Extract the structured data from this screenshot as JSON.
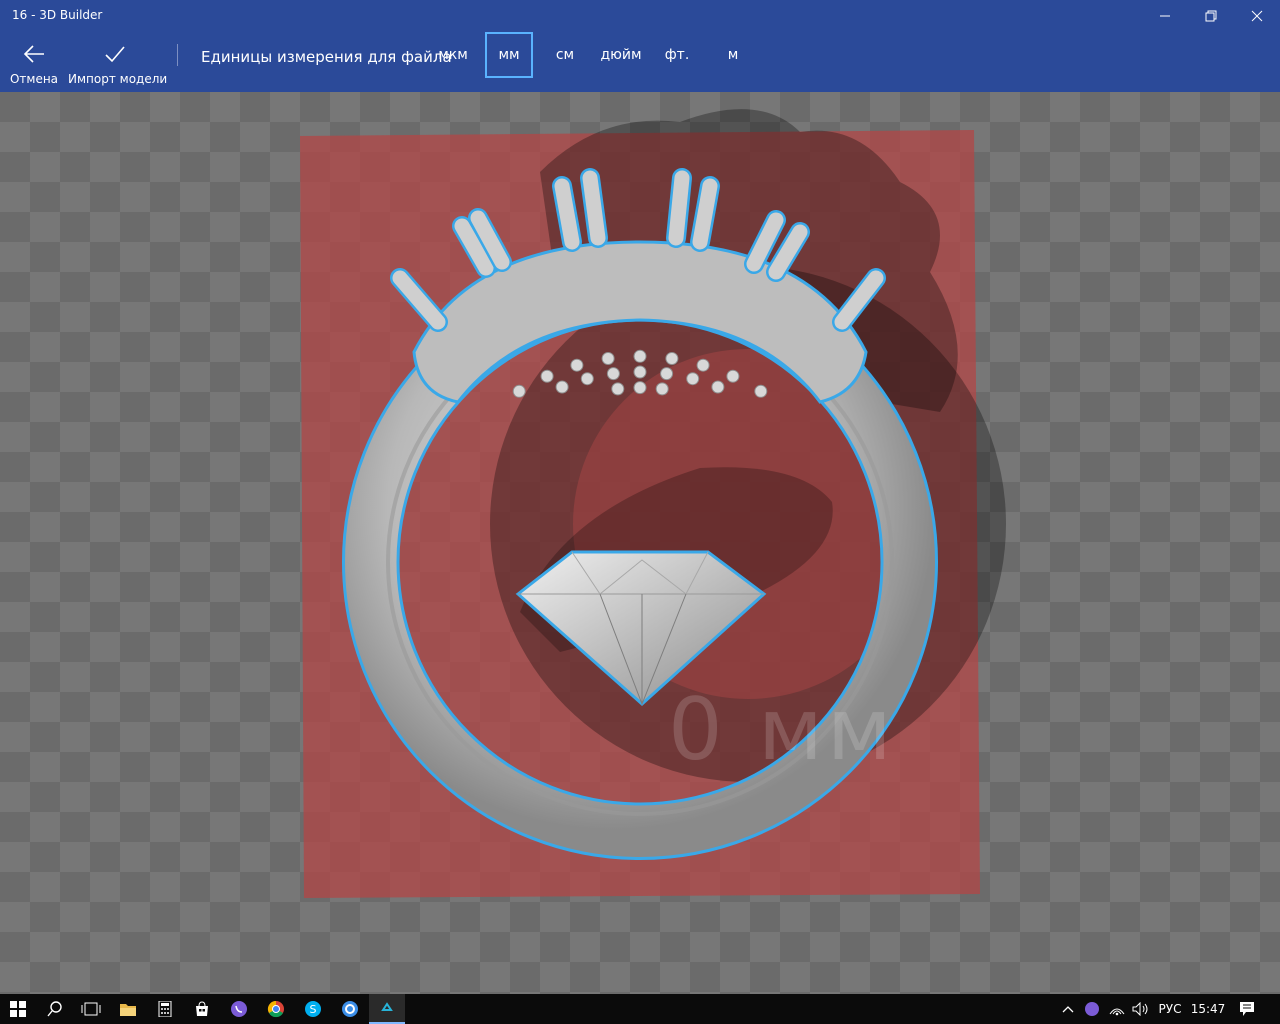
{
  "window": {
    "title": "16 - 3D Builder"
  },
  "toolbar": {
    "cancel_label": "Отмена",
    "import_label": "Импорт модели",
    "units_label": "Единицы измерения для файла",
    "units": [
      "мкм",
      "мм",
      "см",
      "дюйм",
      "фт.",
      "м"
    ],
    "selected_unit": "мм"
  },
  "viewport": {
    "size_label": "0 мм",
    "plate_color": "#b04848",
    "outline_color": "#3aa8e8",
    "model_color": "#c8c8c8"
  },
  "taskbar": {
    "apps": [
      "windows-start",
      "search",
      "task-view",
      "file-explorer",
      "calculator",
      "store",
      "viber",
      "chrome",
      "skype",
      "app-browser",
      "3d-builder"
    ],
    "language": "РУС",
    "time": "15:47"
  }
}
